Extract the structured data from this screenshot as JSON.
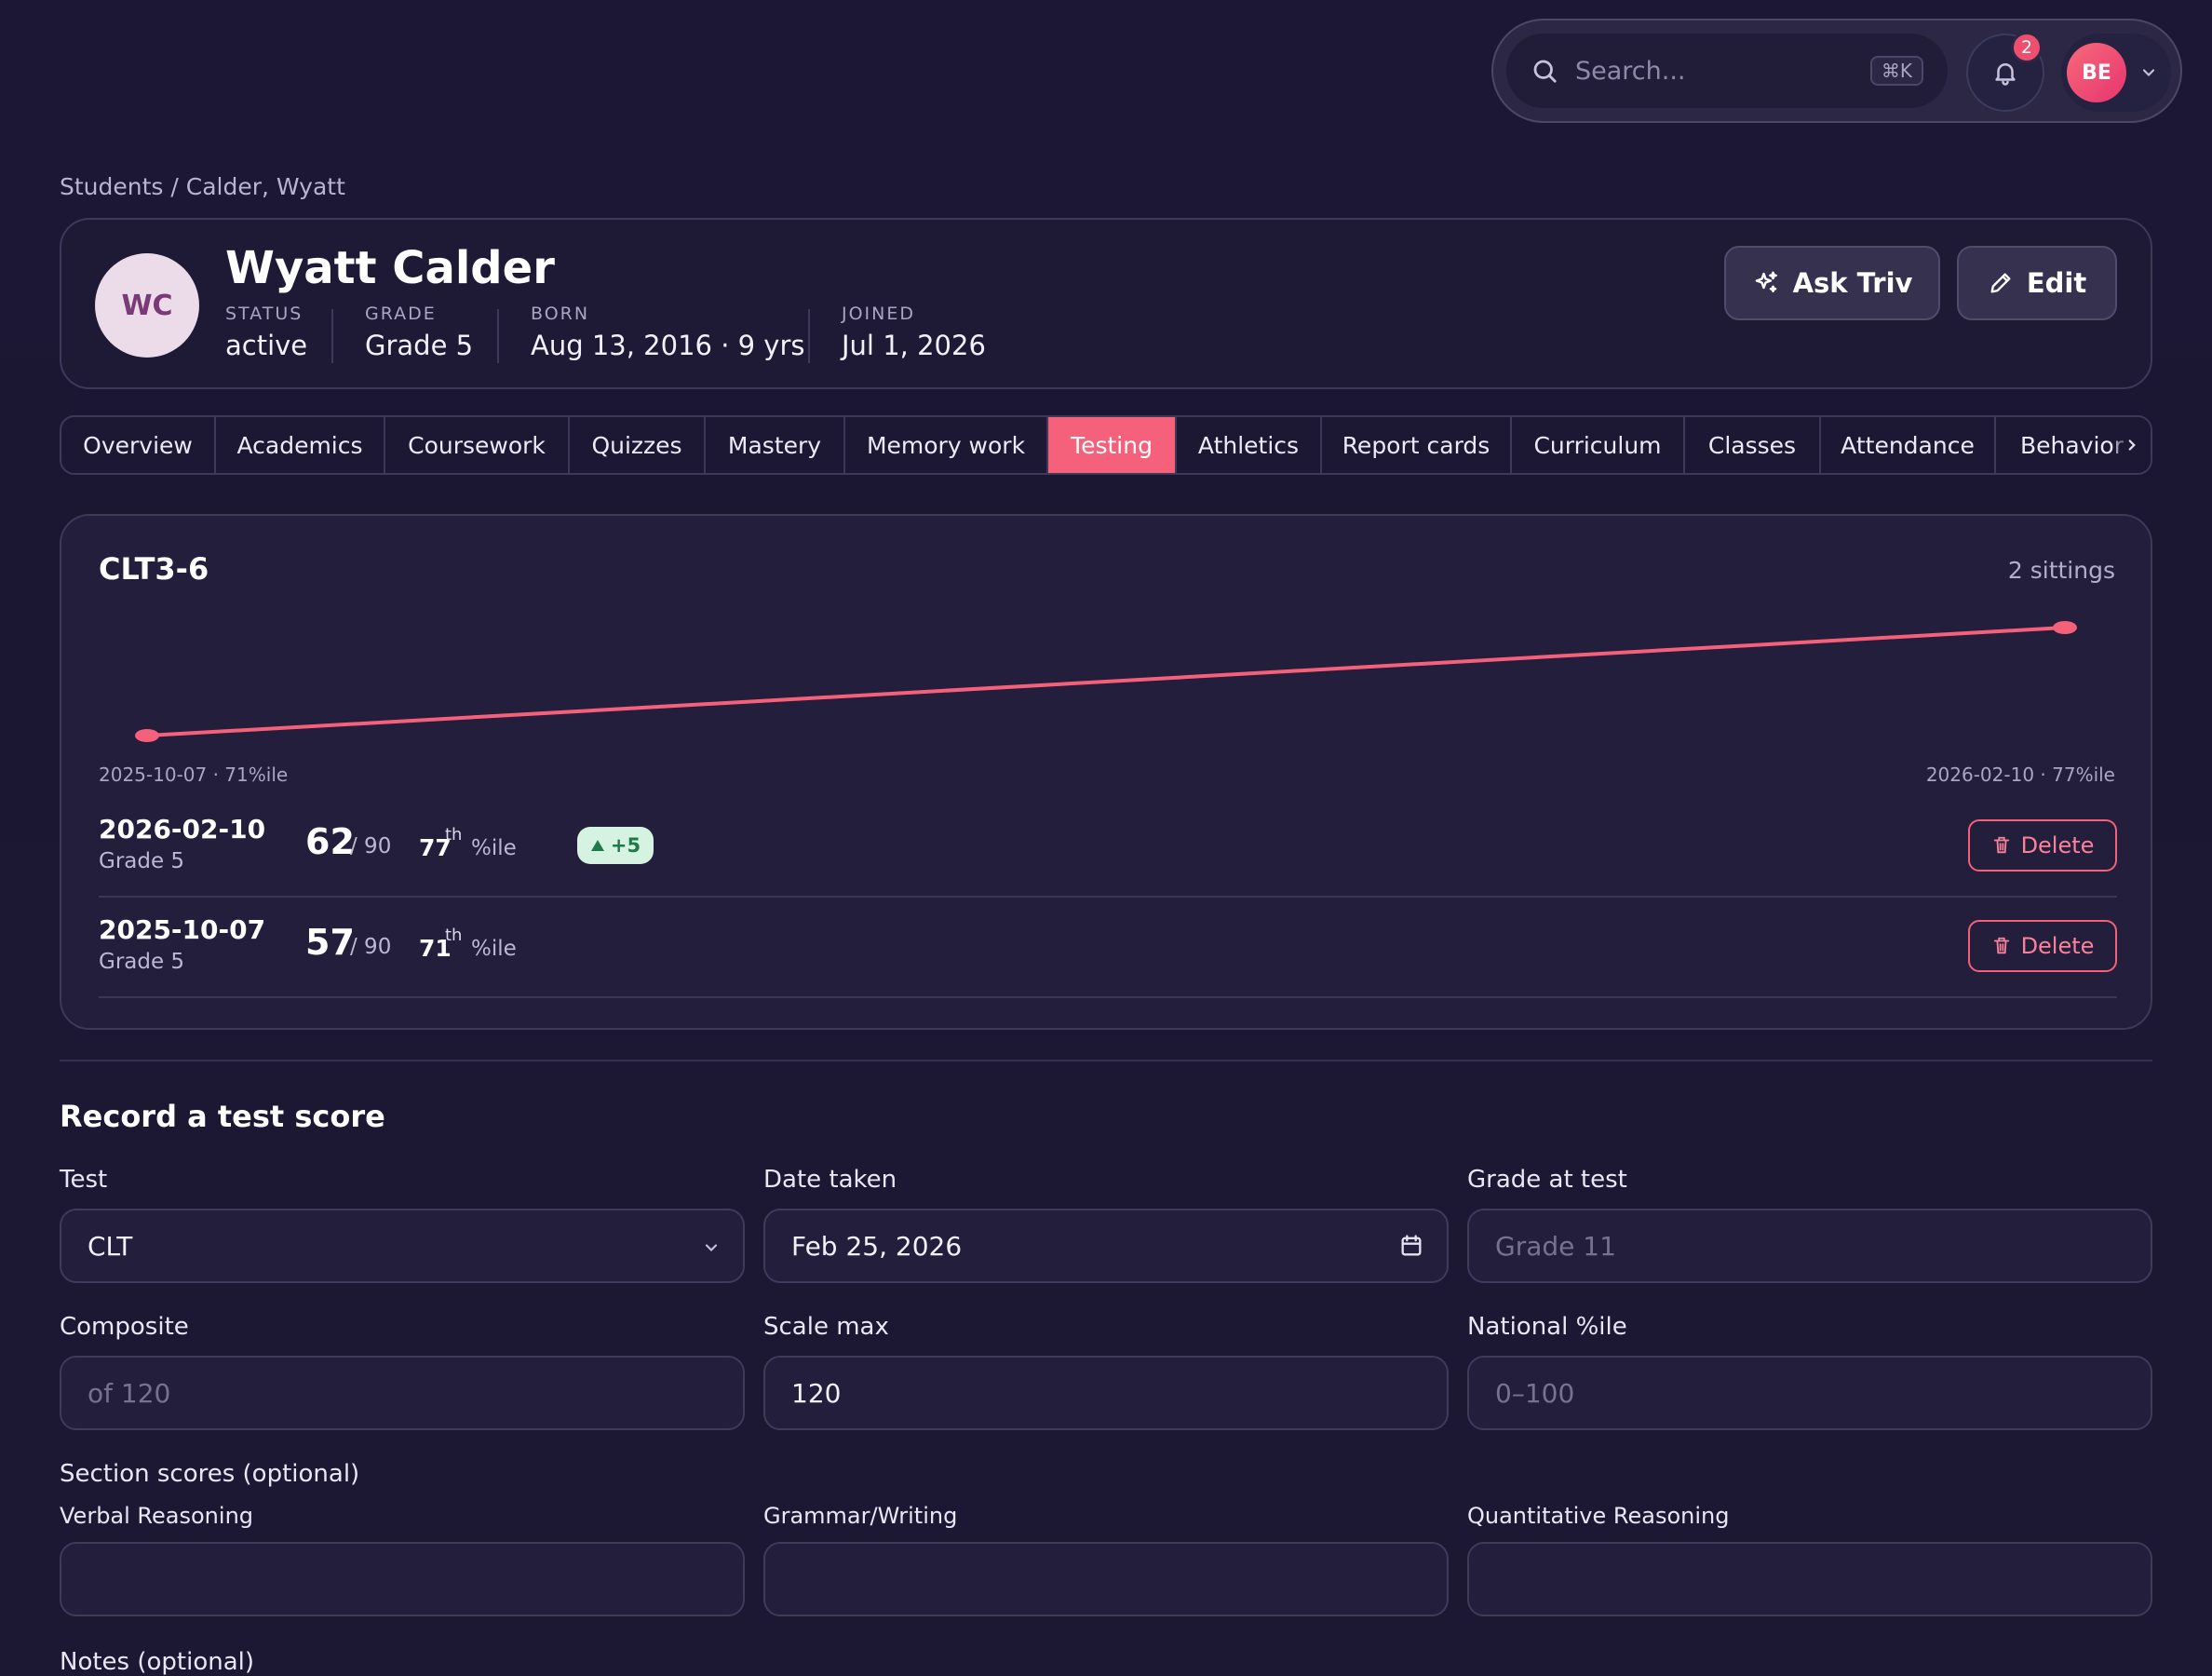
{
  "search": {
    "placeholder": "Search...",
    "shortcut": "⌘K",
    "icon": "search-icon"
  },
  "notifications": {
    "count": "2",
    "icon": "bell-icon"
  },
  "user": {
    "initials": "BE"
  },
  "breadcrumb": "Students / Calder, Wyatt",
  "student": {
    "initials": "WC",
    "name": "Wyatt Calder",
    "status_label": "STATUS",
    "status": "active",
    "grade_label": "GRADE",
    "grade": "Grade 5",
    "born_label": "BORN",
    "born": "Aug 13, 2016 · 9 yrs",
    "joined_label": "JOINED",
    "joined": "Jul 1, 2026"
  },
  "actions": {
    "ask": "Ask Triv",
    "edit": "Edit"
  },
  "tabs": [
    {
      "label": "Overview"
    },
    {
      "label": "Academics"
    },
    {
      "label": "Coursework"
    },
    {
      "label": "Quizzes"
    },
    {
      "label": "Mastery"
    },
    {
      "label": "Memory work"
    },
    {
      "label": "Testing",
      "active": true
    },
    {
      "label": "Athletics"
    },
    {
      "label": "Report cards"
    },
    {
      "label": "Curriculum"
    },
    {
      "label": "Classes"
    },
    {
      "label": "Attendance"
    },
    {
      "label": "Behavior"
    }
  ],
  "test_card": {
    "title": "CLT3-6",
    "sittings": "2 sittings",
    "start_label": "2025-10-07 · 71%ile",
    "end_label": "2026-02-10 · 77%ile",
    "rows": [
      {
        "date": "2026-02-10",
        "grade": "Grade 5",
        "score": "62",
        "max": "/ 90",
        "pct": "77",
        "sup": "th",
        "pct_suffix": "%ile",
        "delta": "+5",
        "delete": "Delete"
      },
      {
        "date": "2025-10-07",
        "grade": "Grade 5",
        "score": "57",
        "max": "/ 90",
        "pct": "71",
        "sup": "th",
        "pct_suffix": "%ile",
        "delete": "Delete"
      }
    ]
  },
  "chart_data": {
    "type": "line",
    "x": [
      "2025-10-07",
      "2026-02-10"
    ],
    "series": [
      {
        "values": [
          71,
          77
        ]
      }
    ],
    "ylim": [
      71,
      77
    ],
    "grid": false,
    "color": "#f5607a"
  },
  "form": {
    "title": "Record a test score",
    "test_label": "Test",
    "test_value": "CLT",
    "date_label": "Date taken",
    "date_value": "Feb 25, 2026",
    "grade_label": "Grade at test",
    "grade_placeholder": "Grade 11",
    "composite_label": "Composite",
    "composite_placeholder": "of 120",
    "scale_label": "Scale max",
    "scale_value": "120",
    "national_label": "National %ile",
    "national_placeholder": "0–100",
    "sections_label": "Section scores (optional)",
    "verbal_label": "Verbal Reasoning",
    "grammar_label": "Grammar/Writing",
    "quant_label": "Quantitative Reasoning",
    "notes_label": "Notes (optional)"
  },
  "colors": {
    "accent": "#f5607a",
    "background": "#1b1734",
    "card": "#221e3b"
  }
}
